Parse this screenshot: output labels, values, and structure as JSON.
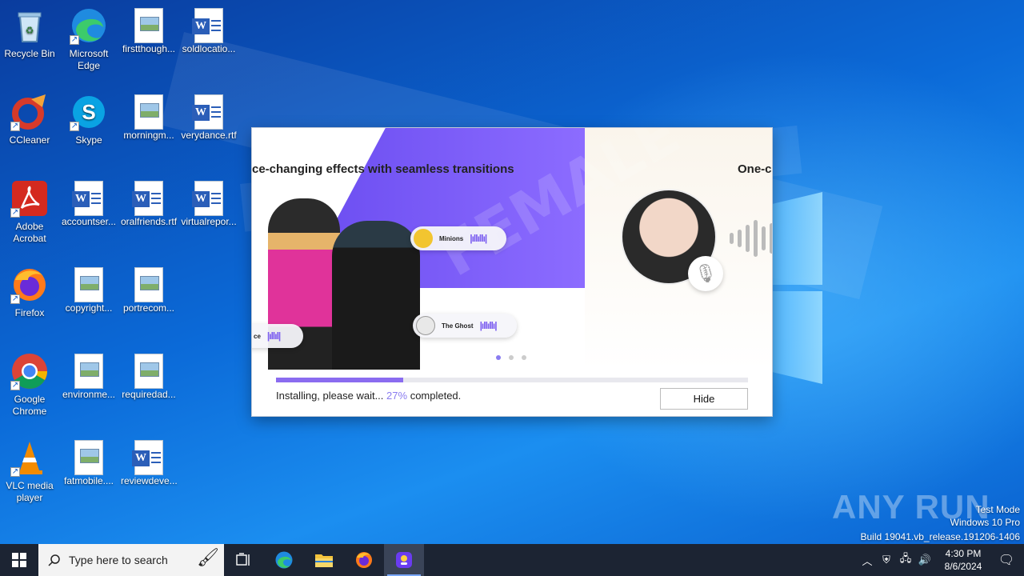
{
  "desktop": {
    "icons": [
      {
        "label": "Recycle Bin"
      },
      {
        "label": "Microsoft Edge"
      },
      {
        "label": "firstthough..."
      },
      {
        "label": "soldlocatio..."
      },
      {
        "label": "CCleaner"
      },
      {
        "label": "Skype"
      },
      {
        "label": "morningm..."
      },
      {
        "label": "verydance.rtf"
      },
      {
        "label": "Adobe Acrobat"
      },
      {
        "label": "accountser..."
      },
      {
        "label": "oralfriends.rtf"
      },
      {
        "label": "virtualrepor..."
      },
      {
        "label": "Firefox"
      },
      {
        "label": "copyright..."
      },
      {
        "label": "portrecom..."
      },
      {
        "label": "Google Chrome"
      },
      {
        "label": "environme..."
      },
      {
        "label": "requiredad..."
      },
      {
        "label": "VLC media player"
      },
      {
        "label": "fatmobile...."
      },
      {
        "label": "reviewdeve..."
      }
    ]
  },
  "installer": {
    "slide_title_left": "ce-changing effects with seamless transitions",
    "slide_title_right": "One-c",
    "band_text": "FEMALE",
    "pill_minions": "Minions",
    "pill_ghost": "The Ghost",
    "pill_partial": "ce",
    "status_prefix": "Installing, please wait...",
    "percent": "27%",
    "status_suffix": "completed.",
    "progress_value": 27,
    "hide_label": "Hide",
    "accent_color": "#8a6cf0"
  },
  "watermark": {
    "logo": "ANY RUN",
    "line1": "Test Mode",
    "line2": "Windows 10 Pro",
    "line3": "Build 19041.vb_release.191206-1406"
  },
  "taskbar": {
    "search_placeholder": "Type here to search",
    "time": "4:30 PM",
    "date": "8/6/2024"
  }
}
